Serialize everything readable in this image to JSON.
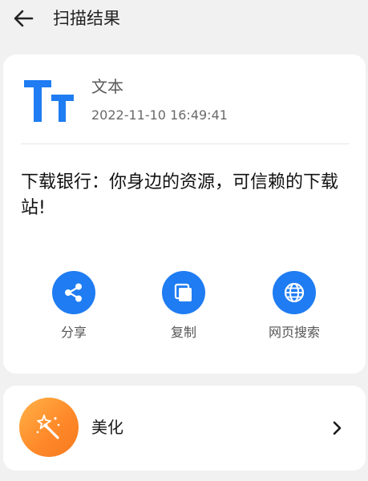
{
  "header": {
    "title": "扫描结果",
    "back_icon": "arrow-left-icon"
  },
  "result": {
    "type_icon": "text-type-icon",
    "type_name": "文本",
    "timestamp": "2022-11-10 16:49:41",
    "content": "下载银行：你身边的资源，可信赖的下载站!"
  },
  "actions": [
    {
      "label": "分享",
      "icon": "share-icon"
    },
    {
      "label": "复制",
      "icon": "copy-icon"
    },
    {
      "label": "网页搜索",
      "icon": "globe-icon"
    }
  ],
  "beautify": {
    "label": "美化",
    "icon": "magic-wand-icon",
    "chevron": "chevron-right-icon"
  },
  "colors": {
    "accent": "#1f7cf2",
    "background": "#f1f1f1",
    "card": "#ffffff",
    "beautify_gradient_start": "#ffb347",
    "beautify_gradient_end": "#f57a1e"
  }
}
